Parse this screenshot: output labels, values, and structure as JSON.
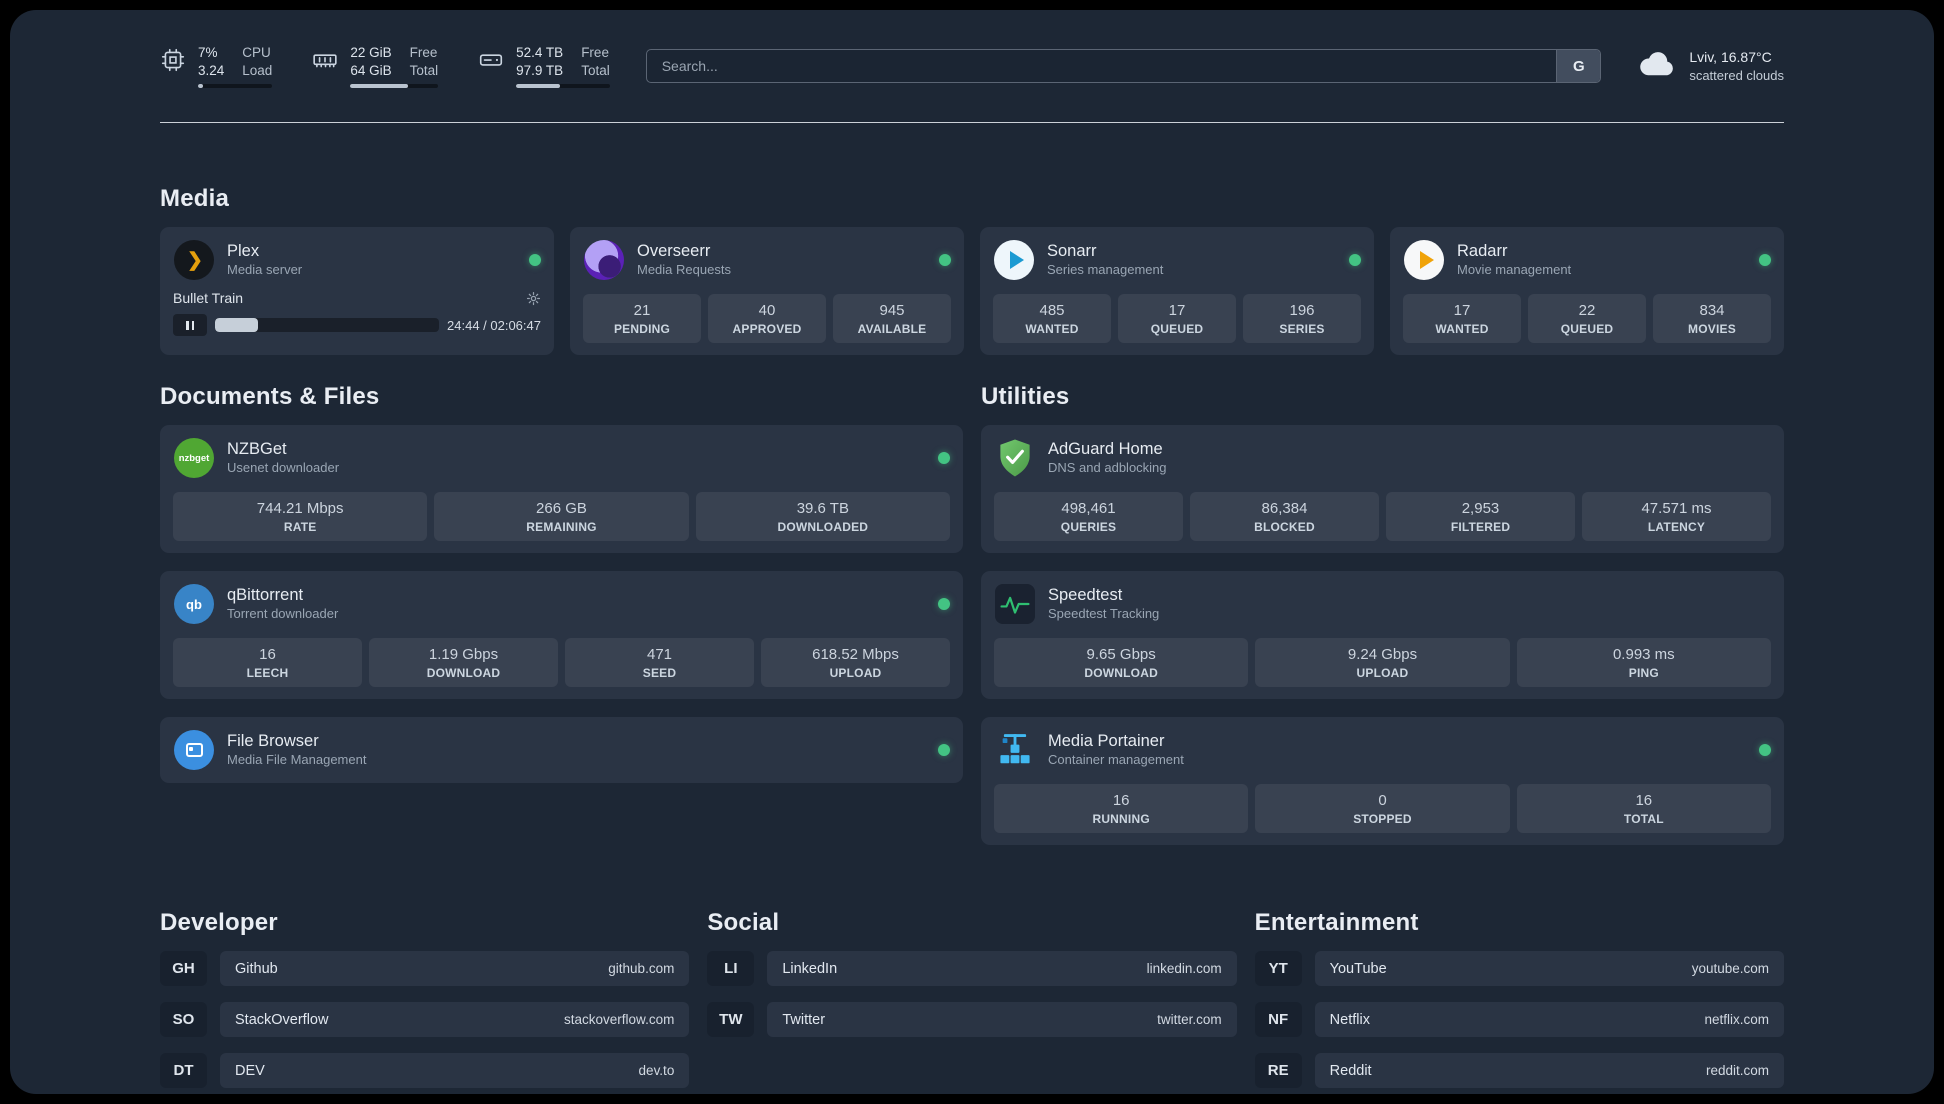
{
  "topbar": {
    "cpu": {
      "values": [
        "7%",
        "3.24"
      ],
      "labels": [
        "CPU",
        "Load"
      ],
      "percent": 7
    },
    "memory": {
      "values": [
        "22 GiB",
        "64 GiB"
      ],
      "labels": [
        "Free",
        "Total"
      ],
      "percent": 66
    },
    "disk": {
      "values": [
        "52.4 TB",
        "97.9 TB"
      ],
      "labels": [
        "Free",
        "Total"
      ],
      "percent": 47
    },
    "search": {
      "placeholder": "Search...",
      "provider": "G"
    },
    "weather": {
      "location": "Lviv, 16.87°C",
      "condition": "scattered clouds"
    }
  },
  "sections": {
    "media": "Media",
    "documents": "Documents & Files",
    "utilities": "Utilities",
    "developer": "Developer",
    "social": "Social",
    "entertainment": "Entertainment"
  },
  "services": {
    "plex": {
      "name": "Plex",
      "subtitle": "Media server",
      "now_playing": "Bullet Train",
      "time": "24:44 / 02:06:47",
      "progress_percent": 19
    },
    "overseerr": {
      "name": "Overseerr",
      "subtitle": "Media Requests",
      "stats": [
        {
          "value": "21",
          "label": "PENDING"
        },
        {
          "value": "40",
          "label": "APPROVED"
        },
        {
          "value": "945",
          "label": "AVAILABLE"
        }
      ]
    },
    "sonarr": {
      "name": "Sonarr",
      "subtitle": "Series management",
      "stats": [
        {
          "value": "485",
          "label": "WANTED"
        },
        {
          "value": "17",
          "label": "QUEUED"
        },
        {
          "value": "196",
          "label": "SERIES"
        }
      ]
    },
    "radarr": {
      "name": "Radarr",
      "subtitle": "Movie management",
      "stats": [
        {
          "value": "17",
          "label": "WANTED"
        },
        {
          "value": "22",
          "label": "QUEUED"
        },
        {
          "value": "834",
          "label": "MOVIES"
        }
      ]
    },
    "nzbget": {
      "name": "NZBGet",
      "subtitle": "Usenet downloader",
      "icon_text": "nzbget",
      "stats": [
        {
          "value": "744.21 Mbps",
          "label": "RATE"
        },
        {
          "value": "266 GB",
          "label": "REMAINING"
        },
        {
          "value": "39.6 TB",
          "label": "DOWNLOADED"
        }
      ]
    },
    "qbittorrent": {
      "name": "qBittorrent",
      "subtitle": "Torrent downloader",
      "icon_text": "qb",
      "stats": [
        {
          "value": "16",
          "label": "LEECH"
        },
        {
          "value": "1.19 Gbps",
          "label": "DOWNLOAD"
        },
        {
          "value": "471",
          "label": "SEED"
        },
        {
          "value": "618.52 Mbps",
          "label": "UPLOAD"
        }
      ]
    },
    "filebrowser": {
      "name": "File Browser",
      "subtitle": "Media File Management"
    },
    "adguard": {
      "name": "AdGuard Home",
      "subtitle": "DNS and adblocking",
      "stats": [
        {
          "value": "498,461",
          "label": "QUERIES"
        },
        {
          "value": "86,384",
          "label": "BLOCKED"
        },
        {
          "value": "2,953",
          "label": "FILTERED"
        },
        {
          "value": "47.571 ms",
          "label": "LATENCY"
        }
      ]
    },
    "speedtest": {
      "name": "Speedtest",
      "subtitle": "Speedtest Tracking",
      "stats": [
        {
          "value": "9.65 Gbps",
          "label": "DOWNLOAD"
        },
        {
          "value": "9.24 Gbps",
          "label": "UPLOAD"
        },
        {
          "value": "0.993 ms",
          "label": "PING"
        }
      ]
    },
    "portainer": {
      "name": "Media Portainer",
      "subtitle": "Container management",
      "stats": [
        {
          "value": "16",
          "label": "RUNNING"
        },
        {
          "value": "0",
          "label": "STOPPED"
        },
        {
          "value": "16",
          "label": "TOTAL"
        }
      ]
    }
  },
  "links": {
    "developer": [
      {
        "abbr": "GH",
        "name": "Github",
        "url": "github.com"
      },
      {
        "abbr": "SO",
        "name": "StackOverflow",
        "url": "stackoverflow.com"
      },
      {
        "abbr": "DT",
        "name": "DEV",
        "url": "dev.to"
      }
    ],
    "social": [
      {
        "abbr": "LI",
        "name": "LinkedIn",
        "url": "linkedin.com"
      },
      {
        "abbr": "TW",
        "name": "Twitter",
        "url": "twitter.com"
      }
    ],
    "entertainment": [
      {
        "abbr": "YT",
        "name": "YouTube",
        "url": "youtube.com"
      },
      {
        "abbr": "NF",
        "name": "Netflix",
        "url": "netflix.com"
      },
      {
        "abbr": "RE",
        "name": "Reddit",
        "url": "reddit.com"
      }
    ]
  }
}
